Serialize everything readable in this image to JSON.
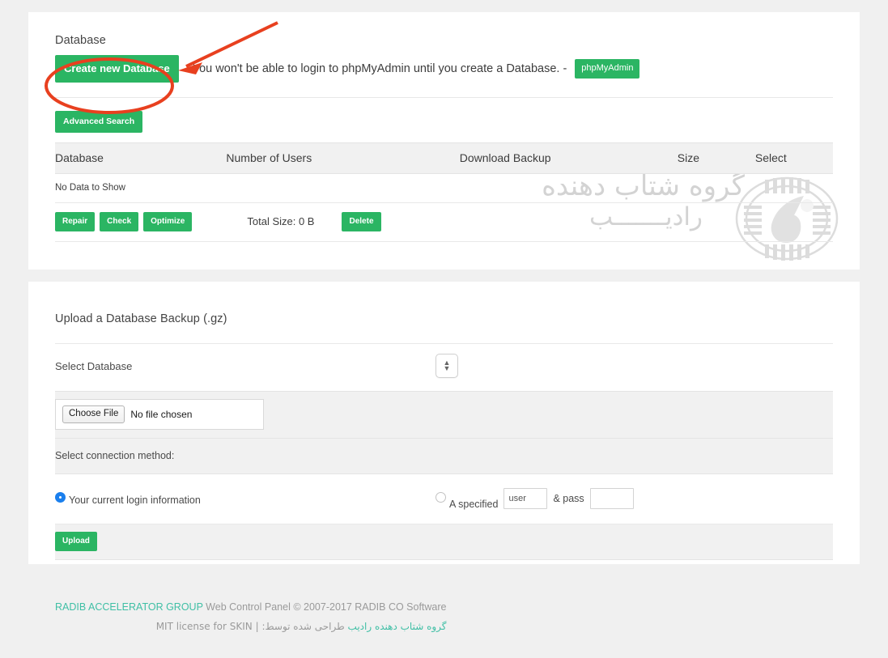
{
  "database_card": {
    "title": "Database",
    "create_button": "Create new Database",
    "notice_text": "You won't be able to login to phpMyAdmin until you create a Database. -",
    "phpmyadmin_tag": "phpMyAdmin",
    "advanced_search_button": "Advanced Search",
    "table": {
      "headers": [
        "Database",
        "Number of Users",
        "Download Backup",
        "Size",
        "Select"
      ],
      "empty_message": "No Data to Show",
      "tools": [
        "Repair",
        "Check",
        "Optimize"
      ],
      "total_size_label": "Total Size: 0 B",
      "delete_button": "Delete"
    }
  },
  "upload_card": {
    "title": "Upload a Database Backup (.gz)",
    "select_database_label": "Select Database",
    "select_database_value": "",
    "file_input": {
      "button_label": "Choose File",
      "status_text": "No file chosen"
    },
    "connection_method_label": "Select connection method:",
    "option_current": {
      "label": "Your current login information",
      "selected": true
    },
    "option_specified": {
      "label": "A specified",
      "selected": false,
      "user_placeholder": "user",
      "amp_pass_label": "& pass",
      "pass_value": ""
    },
    "upload_button": "Upload"
  },
  "watermark": {
    "line1": "گروه شتاب دهنده",
    "line2": "رادیـــــــب"
  },
  "footer": {
    "brand": "RADIB ACCELERATOR GROUP",
    "copyright": "Web Control Panel © 2007-2017 RADIB CO Software",
    "fa_designer": "گروه شتاب دهنده رادیب",
    "fa_prefix": "طراحی شده توسط:",
    "license": "MIT license for SKIN",
    "separator": "|"
  },
  "colors": {
    "green": "#2bb563",
    "annotation_red": "#e8401f",
    "radio_blue": "#1a7fed",
    "brand_teal": "#3fbfa5"
  },
  "annotation": {
    "type": "red-ellipse-and-arrow",
    "target": "Create new Database"
  }
}
